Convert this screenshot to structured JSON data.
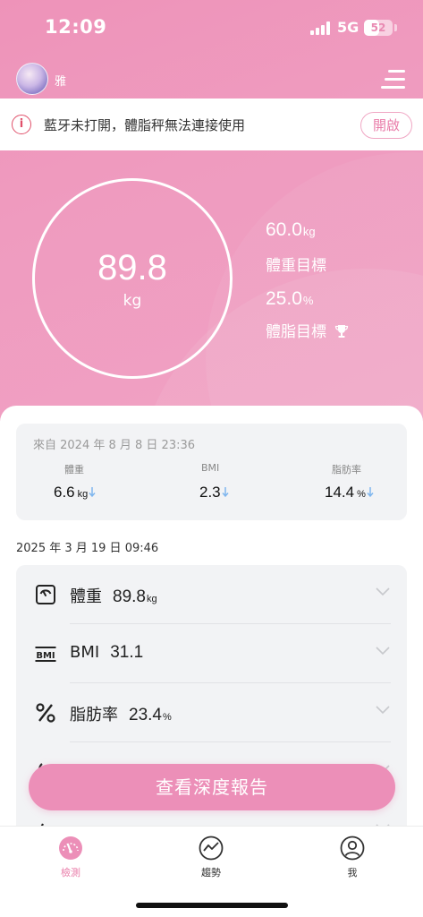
{
  "status_bar": {
    "time": "12:09",
    "network": "5G",
    "battery": "52",
    "battery_level": 0.52
  },
  "header": {
    "user_name": "雅"
  },
  "bluetooth_banner": {
    "message": "藍牙未打開，體脂秤無法連接使用",
    "action_label": "開啟"
  },
  "summary": {
    "weight_value": "89.8",
    "weight_unit": "kg",
    "weight_goal_value": "60.0",
    "weight_goal_unit": "kg",
    "weight_goal_label": "體重目標",
    "fat_goal_value": "25.0",
    "fat_goal_unit": "%",
    "fat_goal_label": "體脂目標"
  },
  "last_record": {
    "source": "來自 2024 年 8 月 8 日 23:36",
    "stats": [
      {
        "label": "體重",
        "value": "6.6",
        "unit": "kg"
      },
      {
        "label": "BMI",
        "value": "2.3",
        "unit": ""
      },
      {
        "label": "脂肪率",
        "value": "14.4",
        "unit": "%"
      }
    ]
  },
  "measurement": {
    "date": "2025 年 3 月 19 日 09:46",
    "metrics": [
      {
        "name": "體重",
        "value": "89.8",
        "unit": "kg",
        "icon": "scale-icon"
      },
      {
        "name": "BMI",
        "value": "31.1",
        "unit": "",
        "icon": "bmi-icon"
      },
      {
        "name": "脂肪率",
        "value": "23.4",
        "unit": "%",
        "icon": "percent-icon"
      }
    ]
  },
  "report_button": "查看深度報告",
  "tabs": [
    {
      "label": "檢測",
      "icon": "gauge-icon",
      "active": true
    },
    {
      "label": "趨勢",
      "icon": "trend-icon",
      "active": false
    },
    {
      "label": "我",
      "icon": "profile-icon",
      "active": false
    }
  ],
  "colors": {
    "accent": "#ec8fb8",
    "down_arrow": "#7fb6ee",
    "alert": "#e0506a"
  }
}
